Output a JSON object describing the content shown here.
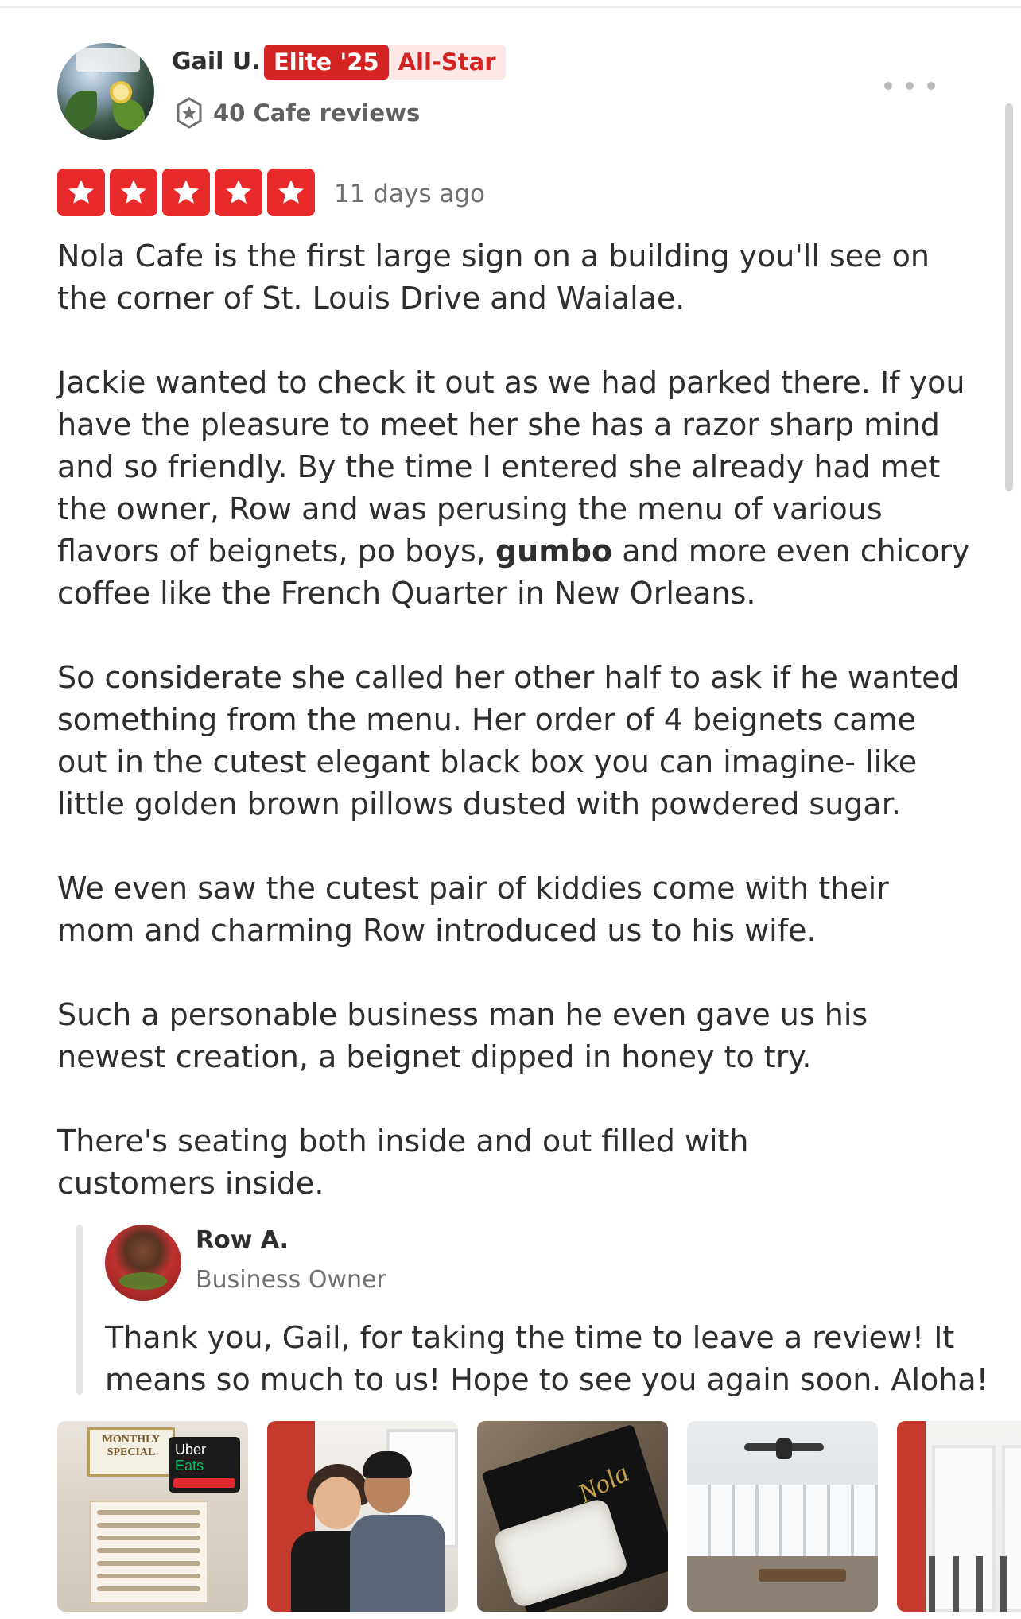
{
  "review": {
    "user": {
      "name": "Gail U.",
      "elite_badge": "Elite '25",
      "allstar_badge": "All-Star",
      "review_count": "40 Cafe reviews"
    },
    "rating": 5,
    "rating_max": 5,
    "date": "11 days ago",
    "paragraphs": [
      "Nola Cafe is the first large sign on a building you'll see on the corner of St. Louis Drive and Waialae.",
      "Jackie wanted to check it out as we had parked there.  If you have the pleasure to meet her she has a razor sharp mind and so friendly.  By the time I entered she already had met the owner, Row and was perusing the menu of various flavors of beignets, po boys,",
      "gumbo",
      "and more even chicory coffee like the French Quarter in New Orleans.",
      "So considerate she called her other half to ask if he wanted something from the menu.  Her order of 4 beignets came out in the cutest elegant black box you can imagine- like little golden brown pillows dusted with powdered sugar.",
      "We even saw the cutest pair of kiddies come with their mom and charming Row introduced us to his wife.",
      "Such a personable business man he even gave us his newest creation, a beignet dipped in honey to try.",
      "There's seating both inside and out filled with customers inside."
    ]
  },
  "owner_reply": {
    "name": "Row A.",
    "role": "Business Owner",
    "text": "Thank you, Gail, for taking the time to leave a review! It means so much to us! Hope to see you again soon. Aloha!"
  },
  "photos": {
    "menu_sign": "MONTHLY SPECIAL",
    "uber_line1": "Uber",
    "uber_line2": "Eats",
    "box_logo": "Nola"
  },
  "colors": {
    "brand_red": "#d32323",
    "star_red": "#e82a2a"
  },
  "icons": {
    "review_count_icon": "star-circle-icon",
    "menu": "more-horizontal-icon",
    "star": "star-icon"
  }
}
